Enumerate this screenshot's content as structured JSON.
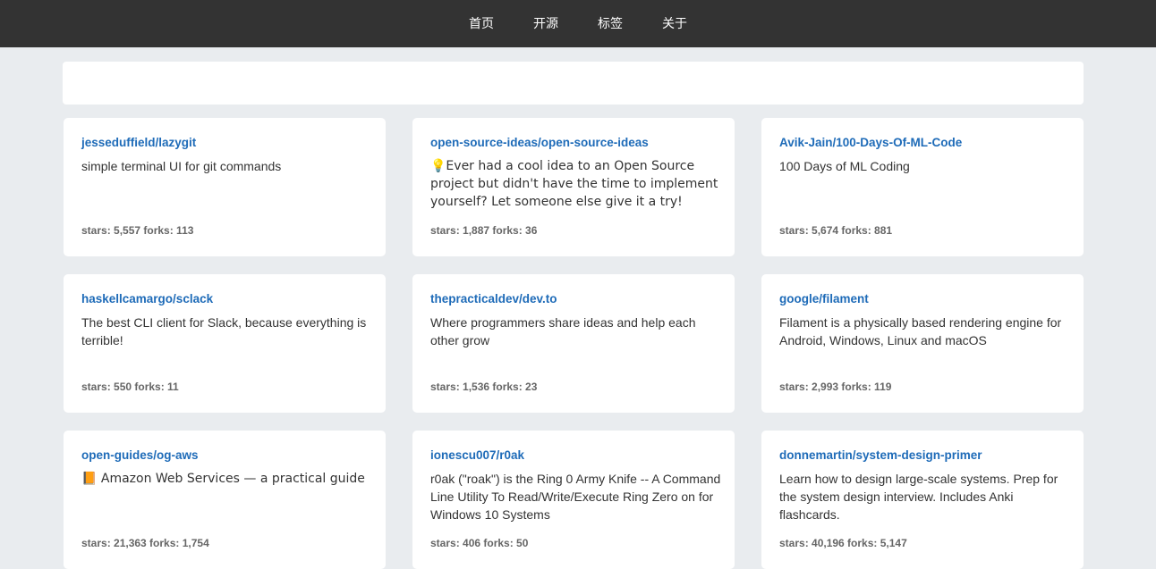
{
  "nav": {
    "items": [
      "首页",
      "开源",
      "标签",
      "关于"
    ]
  },
  "repos": [
    {
      "name": "jesseduffield/lazygit",
      "desc": "simple terminal UI for git commands",
      "stats": "stars: 5,557 forks: 113"
    },
    {
      "name": "open-source-ideas/open-source-ideas",
      "desc": "💡Ever had a cool idea to an Open Source project but didn't have the time to implement yourself? Let someone else give it a try!",
      "stats": "stars: 1,887 forks: 36"
    },
    {
      "name": "Avik-Jain/100-Days-Of-ML-Code",
      "desc": "100 Days of ML Coding",
      "stats": "stars: 5,674 forks: 881"
    },
    {
      "name": "haskellcamargo/sclack",
      "desc": "The best CLI client for Slack, because everything is terrible!",
      "stats": "stars: 550 forks: 11"
    },
    {
      "name": "thepracticaldev/dev.to",
      "desc": "Where programmers share ideas and help each other grow",
      "stats": "stars: 1,536 forks: 23"
    },
    {
      "name": "google/filament",
      "desc": "Filament is a physically based rendering engine for Android, Windows, Linux and macOS",
      "stats": "stars: 2,993 forks: 119"
    },
    {
      "name": "open-guides/og-aws",
      "desc": "📙 Amazon Web Services — a practical guide",
      "stats": "stars: 21,363 forks: 1,754"
    },
    {
      "name": "ionescu007/r0ak",
      "desc": "r0ak (\"roak\") is the Ring 0 Army Knife -- A Command Line Utility To Read/Write/Execute Ring Zero on for Windows 10 Systems",
      "stats": "stars: 406 forks: 50"
    },
    {
      "name": "donnemartin/system-design-primer",
      "desc": "Learn how to design large-scale systems. Prep for the system design interview. Includes Anki flashcards.",
      "stats": "stars: 40,196 forks: 5,147"
    }
  ]
}
